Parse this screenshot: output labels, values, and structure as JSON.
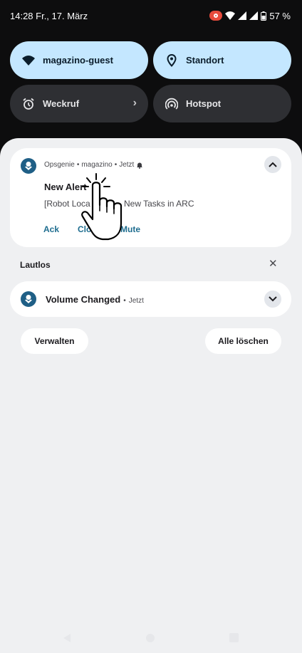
{
  "status_bar": {
    "time_date": "14:28 Fr., 17. März",
    "battery_text": "57 %"
  },
  "quick_tiles": [
    {
      "label": "magazino-guest",
      "icon": "wifi-icon",
      "state": "on"
    },
    {
      "label": "Standort",
      "icon": "location-icon",
      "state": "on"
    },
    {
      "label": "Weckruf",
      "icon": "alarm-icon",
      "state": "off",
      "has_chevron": true
    },
    {
      "label": "Hotspot",
      "icon": "hotspot-icon",
      "state": "off"
    }
  ],
  "notifications": {
    "opsgenie": {
      "app": "Opsgenie",
      "separator1": "•",
      "source": "magazino",
      "separator2": "•",
      "time": "Jetzt",
      "title": "New Alert",
      "text": "[Robot Loca",
      "text_tail": "New Tasks in ARC",
      "actions": {
        "ack": "Ack",
        "close": "Clo",
        "mute": "Mute"
      }
    },
    "silent_section": {
      "label": "Lautlos"
    },
    "volume": {
      "title": "Volume Changed",
      "separator": "•",
      "time": "Jetzt"
    }
  },
  "buttons": {
    "manage": "Verwalten",
    "clear_all": "Alle löschen"
  },
  "colors": {
    "tile_active": "#c4e7ff",
    "tile_inactive": "#2e2f33",
    "accent": "#1e6d8f",
    "shade_bg": "#eff0f2"
  }
}
